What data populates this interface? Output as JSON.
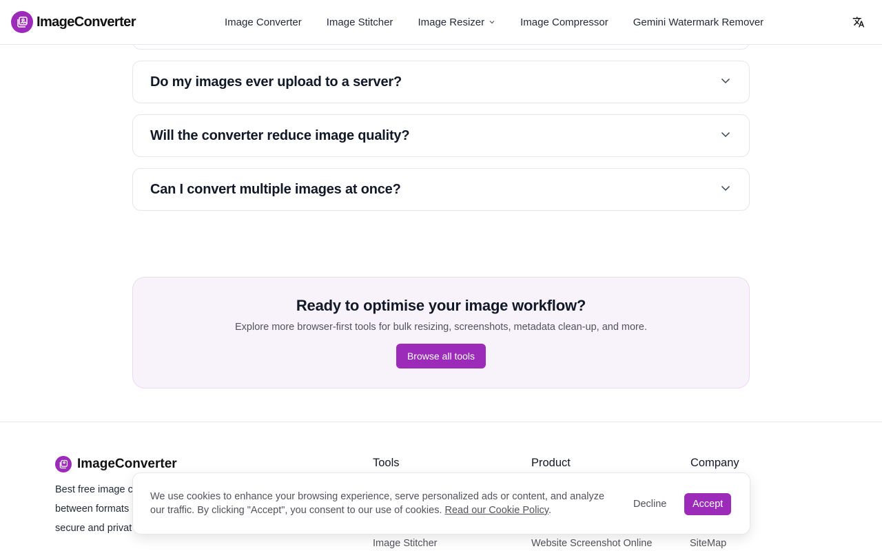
{
  "header": {
    "logo_text": "ImageConverter",
    "nav": [
      {
        "label": "Image Converter"
      },
      {
        "label": "Image Stitcher"
      },
      {
        "label": "Image Resizer"
      },
      {
        "label": "Image Compressor"
      },
      {
        "label": "Gemini Watermark Remover"
      }
    ],
    "language_icon": "translate-icon"
  },
  "faq": {
    "items": [
      {
        "question": "Do my images ever upload to a server?"
      },
      {
        "question": "Will the converter reduce image quality?"
      },
      {
        "question": "Can I convert multiple images at once?"
      }
    ],
    "icon": "chevron-down-icon"
  },
  "cta": {
    "title": "Ready to optimise your image workflow?",
    "subtitle": "Explore more browser-first tools for bulk resizing, screenshots, metadata clean-up, and more.",
    "button": "Browse all tools"
  },
  "footer": {
    "brand": "ImageConverter",
    "description": "Best free image converter between formats, secure and private",
    "desc_lines": [
      "Best free image c",
      "between formats",
      "secure and privat"
    ],
    "columns": [
      {
        "title": "Tools",
        "visible_link": "Image Stitcher"
      },
      {
        "title": "Product",
        "visible_link": "Website Screenshot Online"
      },
      {
        "title": "Company",
        "visible_link": "SiteMap"
      }
    ]
  },
  "cookie": {
    "text": "We use cookies to enhance your browsing experience, serve personalized ads or content, and analyze our traffic. By clicking \"Accept\", you consent to our use of cookies.",
    "link": "Read our Cookie Policy",
    "decline": "Decline",
    "accept": "Accept"
  },
  "colors": {
    "brand": "#9b2bb8",
    "cta_bg": "#f8f3fa",
    "border": "#e5e7eb"
  }
}
